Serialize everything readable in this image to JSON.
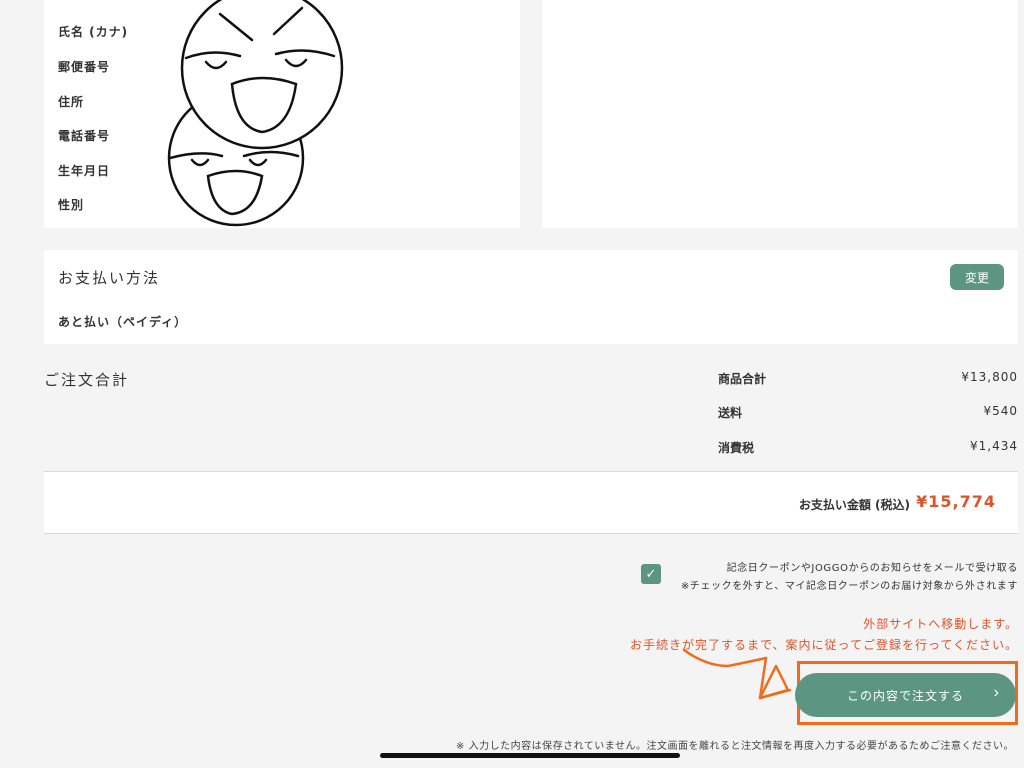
{
  "customer": {
    "fields": [
      "氏名 (カナ)",
      "郵便番号",
      "住所",
      "電話番号",
      "生年月日",
      "性別"
    ]
  },
  "payment": {
    "title": "お支払い方法",
    "change_label": "変更",
    "method": "あと払い（ペイディ）"
  },
  "summary": {
    "title": "ご注文合計",
    "rows": [
      {
        "label": "商品合計",
        "value": "¥13,800"
      },
      {
        "label": "送料",
        "value": "¥540"
      },
      {
        "label": "消費税",
        "value": "¥1,434"
      }
    ],
    "total_label": "お支払い金額 (税込)",
    "total_value": "¥15,774"
  },
  "consent": {
    "checked": true,
    "line1": "記念日クーポンやJOGGOからのお知らせをメールで受け取る",
    "line2": "※チェックを外すと、マイ記念日クーポンのお届け対象から外されます"
  },
  "notice": {
    "line1": "外部サイトへ移動します。",
    "line2": "お手続きが完了するまで、案内に従ってご登録を行ってください。"
  },
  "order_button": {
    "label": "この内容で注文する",
    "chevron": "›"
  },
  "footnote": "※ 入力した内容は保存されていません。注文画面を離れると注文情報を再度入力する必要があるためご注意ください。",
  "colors": {
    "accent": "#5c9682",
    "price": "#e0532a",
    "annotation": "#f26b1d"
  },
  "icons": {
    "check": "check-icon",
    "chevron": "chevron-right-icon"
  }
}
